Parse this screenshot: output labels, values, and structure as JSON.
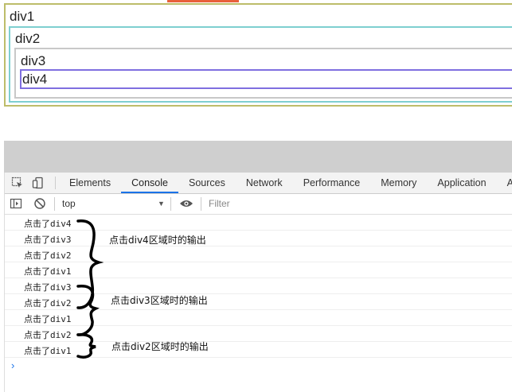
{
  "demo": {
    "div1": "div1",
    "div2": "div2",
    "div3": "div3",
    "div4": "div4"
  },
  "devtools": {
    "tabs": [
      {
        "label": "Elements"
      },
      {
        "label": "Console",
        "active": true
      },
      {
        "label": "Sources"
      },
      {
        "label": "Network"
      },
      {
        "label": "Performance"
      },
      {
        "label": "Memory"
      },
      {
        "label": "Application"
      },
      {
        "label": "Audits"
      }
    ],
    "context_select": "top",
    "filter_placeholder": "Filter",
    "icons": [
      "inspect-element-icon",
      "device-toolbar-icon",
      "sidebar-toggle-icon",
      "clear-console-icon",
      "eye-icon",
      "dropdown-arrow-icon",
      "prompt-chevron-icon"
    ],
    "accent_color": "#1a73e8",
    "console_logs": [
      "点击了div4",
      "点击了div3",
      "点击了div2",
      "点击了div1",
      "点击了div3",
      "点击了div2",
      "点击了div1",
      "点击了div2",
      "点击了div1"
    ],
    "annotations": [
      "点击div4区域时的输出",
      "点击div3区域时的输出",
      "点击div2区域时的输出"
    ],
    "prompt": "›"
  }
}
